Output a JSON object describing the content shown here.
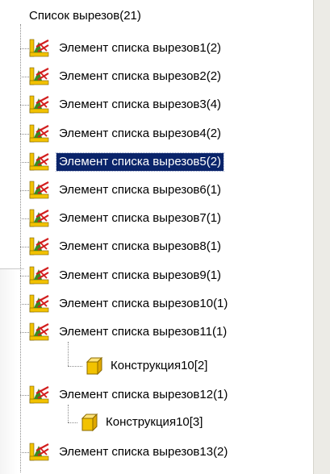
{
  "tree": {
    "root_label": "Список вырезов(21)",
    "items": [
      {
        "label": "Элемент списка вырезов1(2)",
        "icon": "cut-list-item-icon",
        "selected": false
      },
      {
        "label": "Элемент списка вырезов2(2)",
        "icon": "cut-list-item-icon",
        "selected": false
      },
      {
        "label": "Элемент списка вырезов3(4)",
        "icon": "cut-list-item-icon",
        "selected": false
      },
      {
        "label": "Элемент списка вырезов4(2)",
        "icon": "cut-list-item-icon",
        "selected": false
      },
      {
        "label": "Элемент списка вырезов5(2)",
        "icon": "cut-list-item-icon",
        "selected": true
      },
      {
        "label": "Элемент списка вырезов6(1)",
        "icon": "cut-list-item-icon",
        "selected": false
      },
      {
        "label": "Элемент списка вырезов7(1)",
        "icon": "cut-list-item-icon",
        "selected": false
      },
      {
        "label": "Элемент списка вырезов8(1)",
        "icon": "cut-list-item-icon",
        "selected": false
      },
      {
        "label": "Элемент списка вырезов9(1)",
        "icon": "cut-list-item-icon",
        "selected": false
      },
      {
        "label": "Элемент списка вырезов10(1)",
        "icon": "cut-list-item-icon",
        "selected": false
      },
      {
        "label": "Элемент списка вырезов11(1)",
        "icon": "cut-list-item-icon",
        "selected": false,
        "children": [
          {
            "label": "Конструкция10[2]",
            "icon": "structure-body-icon"
          }
        ]
      },
      {
        "label": "Элемент списка вырезов12(1)",
        "icon": "cut-list-item-icon",
        "selected": false,
        "children": [
          {
            "label": "Конструкция10[3]",
            "icon": "structure-body-icon"
          }
        ]
      },
      {
        "label": "Элемент списка вырезов13(2)",
        "icon": "cut-list-item-icon",
        "selected": false
      }
    ]
  },
  "colors": {
    "selection_bg": "#0a246a",
    "selection_text": "#ffffff",
    "icon_yellow": "#f2c200",
    "icon_green": "#3a8a22",
    "icon_red": "#d21e1e"
  }
}
